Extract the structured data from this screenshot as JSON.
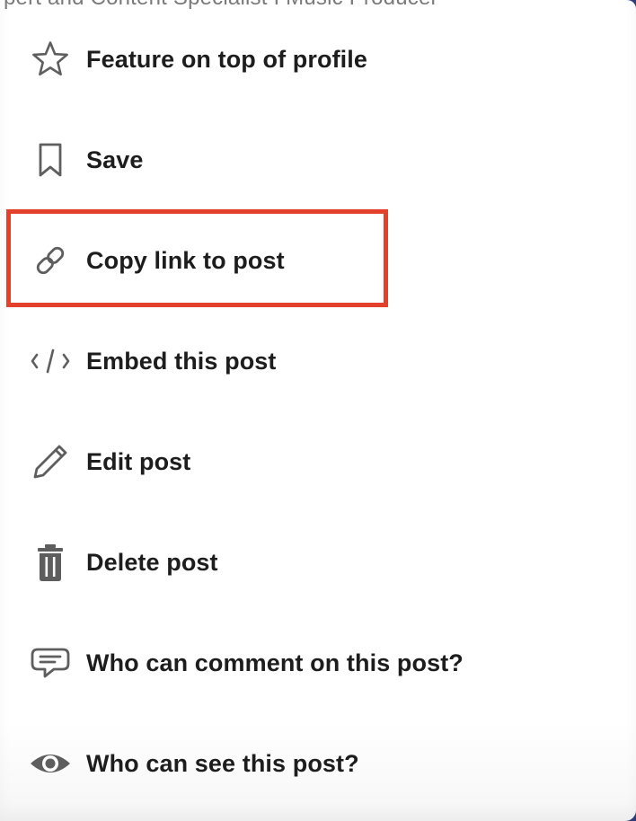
{
  "header": {
    "cut_text": "pert and Content Specialist I Music Producer"
  },
  "menu": {
    "items": [
      {
        "icon": "star-icon",
        "label": "Feature on top of profile"
      },
      {
        "icon": "bookmark-icon",
        "label": "Save"
      },
      {
        "icon": "link-icon",
        "label": "Copy link to post"
      },
      {
        "icon": "code-icon",
        "label": "Embed this post"
      },
      {
        "icon": "pencil-icon",
        "label": "Edit post"
      },
      {
        "icon": "trash-icon",
        "label": "Delete post"
      },
      {
        "icon": "comment-icon",
        "label": "Who can comment on this post?"
      },
      {
        "icon": "eye-icon",
        "label": "Who can see this post?"
      }
    ],
    "highlighted_item": "Copy link to post",
    "highlight_color": "#e3412b",
    "icon_color": "#5e5e5e",
    "text_color": "#1d1d1d"
  }
}
